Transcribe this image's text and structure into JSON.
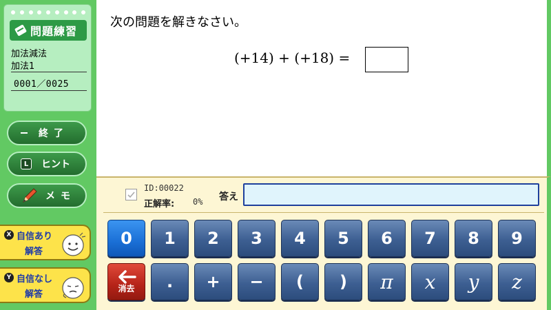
{
  "sidebar": {
    "title": "問題練習",
    "category": "加法減法",
    "subcategory": "加法1",
    "progress": "0001／0025",
    "buttons": {
      "end": "終了",
      "hint_key": "L",
      "hint": "ヒント",
      "memo": "メモ"
    },
    "confidence": {
      "yes_key": "X",
      "yes_line1": "自信あり",
      "yes_line2": "解答",
      "no_key": "Y",
      "no_line1": "自信なし",
      "no_line2": "解答"
    }
  },
  "question": {
    "instruction": "次の問題を解きなさい。",
    "expression": "(+14) + (+18) ="
  },
  "input_panel": {
    "id_text": "ID:00022",
    "rate_label": "正解率:",
    "rate_value": "0%",
    "answer_label": "答え",
    "answer_value": ""
  },
  "keypad": {
    "row1": [
      "0",
      "1",
      "2",
      "3",
      "4",
      "5",
      "6",
      "7",
      "8",
      "9"
    ],
    "row2": [
      ".",
      "+",
      "−",
      "(",
      ")",
      "π",
      "x",
      "y",
      "z"
    ],
    "backspace_label": "消去"
  },
  "colors": {
    "sidebar_green": "#62c963",
    "key_blue": "#3d5f92",
    "key_selected": "#1a6fd6",
    "key_delete": "#b52318",
    "confidence_yellow": "#fde34a"
  }
}
